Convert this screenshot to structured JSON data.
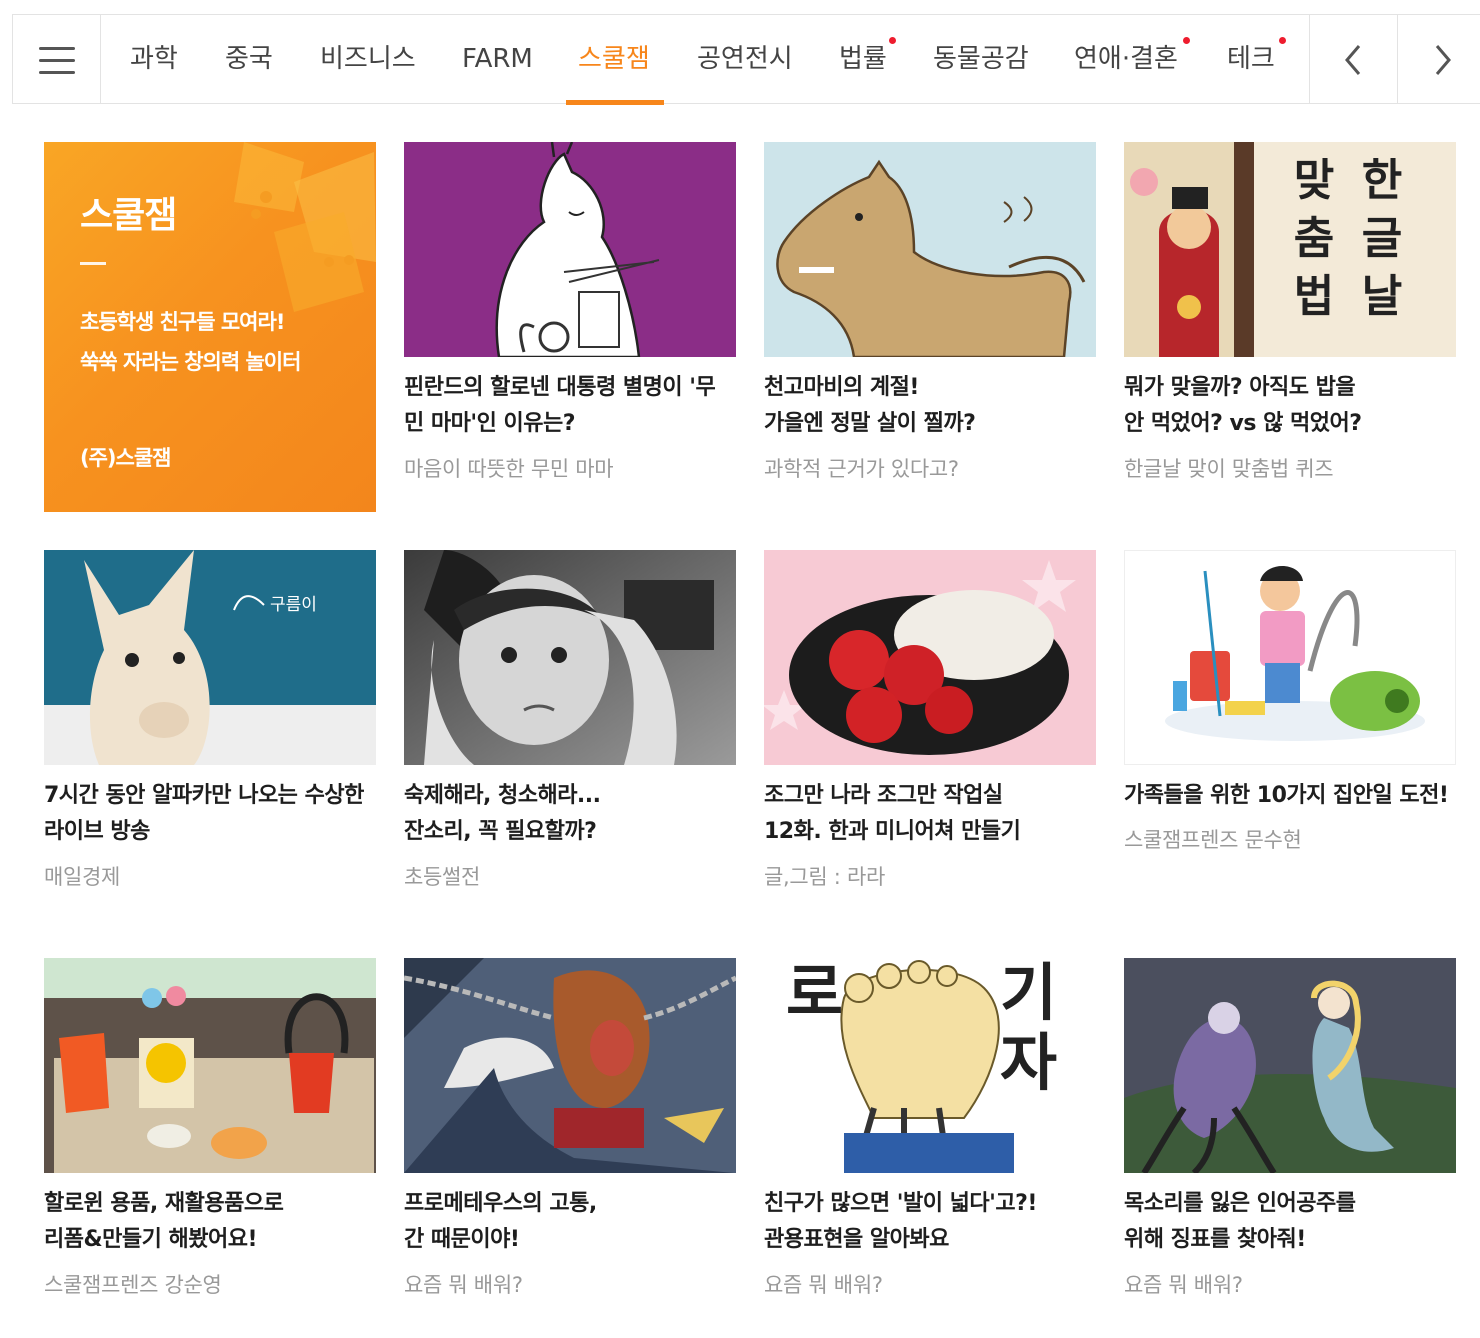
{
  "tabs": [
    {
      "label": "과학"
    },
    {
      "label": "중국"
    },
    {
      "label": "비즈니스"
    },
    {
      "label": "FARM"
    },
    {
      "label": "스쿨잼"
    },
    {
      "label": "공연전시"
    },
    {
      "label": "법률"
    },
    {
      "label": "동물공감"
    },
    {
      "label": "연애·결혼"
    },
    {
      "label": "테크"
    }
  ],
  "accent_color": "#f7861b",
  "new_dot_color": "#ee1c2e",
  "promo": {
    "title": "스쿨잼",
    "desc_line1": "초등학생 친구들 모여라!",
    "desc_line2": "쑥쑥 자라는 창의력 놀이터",
    "company": "(주)스쿨잼"
  },
  "articles": [
    {
      "title_line1": "핀란드의 할로넨 대통령 별명이 '무",
      "title_line2": "민 마마'인 이유는?",
      "source": "마음이 따뜻한 무민 마마"
    },
    {
      "title_line1": "천고마비의 계절!",
      "title_line2": "가을엔 정말 살이 찔까?",
      "source": "과학적 근거가 있다고?"
    },
    {
      "title_line1": "뭐가 맞을까? 아직도 밥을",
      "title_line2": "안 먹었어? vs 않 먹었어?",
      "source": "한글날 맞이 맞춤법 퀴즈"
    },
    {
      "title_line1": "7시간 동안 알파카만 나오는 수상한",
      "title_line2": "라이브 방송",
      "source": "매일경제"
    },
    {
      "title_line1": "숙제해라, 청소해라...",
      "title_line2": "잔소리, 꼭 필요할까?",
      "source": "초등썰전"
    },
    {
      "title_line1": "조그만 나라 조그만 작업실",
      "title_line2": "12화. 한과 미니어쳐 만들기",
      "source": "글,그림 : 라라"
    },
    {
      "title_line1": "가족들을 위한 10가지 집안일 도전!",
      "title_line2": "",
      "source": "스쿨잼프렌즈 문수현"
    },
    {
      "title_line1": "할로윈 용품, 재활용품으로",
      "title_line2": "리폼&만들기 해봤어요!",
      "source": "스쿨잼프렌즈 강순영"
    },
    {
      "title_line1": "프로메테우스의 고통,",
      "title_line2": "간 때문이야!",
      "source": "요즘 뭐 배워?"
    },
    {
      "title_line1": "친구가 많으면 '발이 넓다'고?!",
      "title_line2": "관용표현을 알아봐요",
      "source": "요즘 뭐 배워?"
    },
    {
      "title_line1": "목소리를 잃은 인어공주를",
      "title_line2": "위해 징표를 찾아줘!",
      "source": "요즘 뭐 배워?"
    }
  ],
  "thumb_text": {
    "hangul_col1": "한글날",
    "hangul_col2": "맞춤법",
    "alpaca_tag": "구름이",
    "foot_sign_left": "로",
    "foot_sign_right": "기자"
  }
}
